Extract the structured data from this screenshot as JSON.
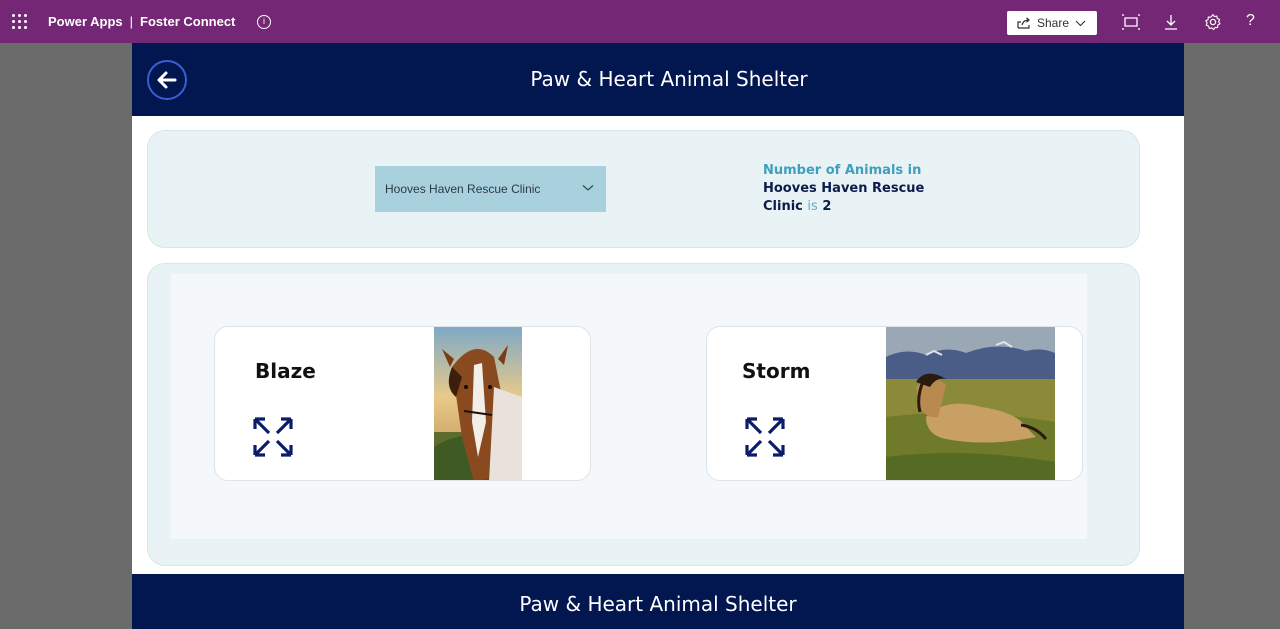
{
  "topbar": {
    "app_name": "Power Apps",
    "separator": "|",
    "app_title": "Foster Connect",
    "info_glyph": "i",
    "share_label": "Share",
    "icons": [
      "waffle-icon",
      "info-icon",
      "share-icon",
      "fit-screen-icon",
      "download-icon",
      "settings-icon",
      "help-icon"
    ],
    "help_glyph": "?"
  },
  "header": {
    "title": "Paw & Heart Animal Shelter"
  },
  "filter": {
    "selected_location": "Hooves Haven Rescue Clinic",
    "count_prefix": "Number of Animals in",
    "count_location": "Hooves Haven Rescue Clinic",
    "count_is": "is",
    "count_value": "2"
  },
  "gallery": {
    "animals": [
      {
        "name": "Blaze"
      },
      {
        "name": "Storm"
      }
    ]
  },
  "footer": {
    "title": "Paw & Heart Animal Shelter"
  },
  "colors": {
    "powerapps_purple": "#742774",
    "navy": "#021650",
    "panel": "#e9f3f6",
    "dropdown": "#a9d0dd",
    "teal_text": "#3f9fbd",
    "icon_navy": "#0b1c6b"
  }
}
